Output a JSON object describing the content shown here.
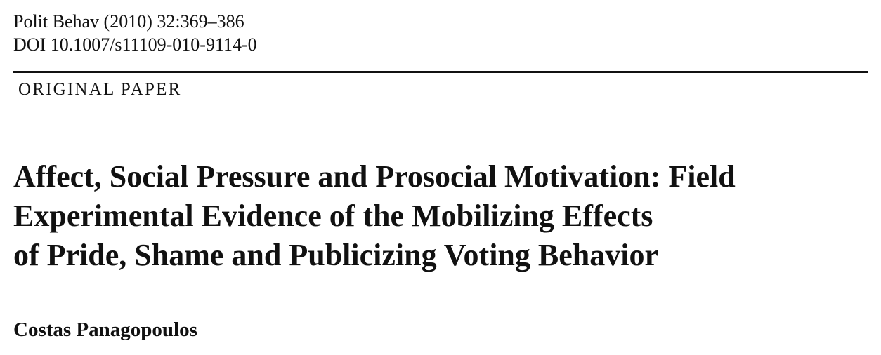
{
  "header": {
    "journal_line": "Polit Behav (2010) 32:369–386",
    "doi_line": "DOI 10.1007/s11109-010-9114-0"
  },
  "paper_type": "ORIGINAL PAPER",
  "title_lines": [
    "Affect, Social Pressure and Prosocial Motivation: Field",
    "Experimental Evidence of the Mobilizing Effects",
    "of Pride, Shame and Publicizing Voting Behavior"
  ],
  "author": "Costas Panagopoulos"
}
